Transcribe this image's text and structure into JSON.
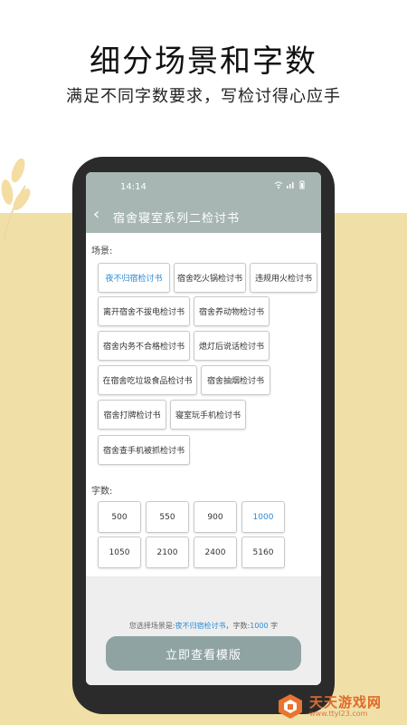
{
  "promo": {
    "headline": "细分场景和字数",
    "subline": "满足不同字数要求，写检讨得心应手"
  },
  "statusbar": {
    "time": "14:14",
    "icons": [
      "wifi-icon",
      "signal-icon",
      "battery-icon"
    ]
  },
  "titlebar": {
    "title": "宿舍寝室系列二检讨书"
  },
  "scenes": {
    "label": "场景:",
    "items": [
      {
        "label": "夜不归宿检讨书",
        "selected": true
      },
      {
        "label": "宿舍吃火锅检讨书",
        "selected": false
      },
      {
        "label": "违规用火检讨书",
        "selected": false
      },
      {
        "label": "离开宿舍不拔电检讨书",
        "selected": false
      },
      {
        "label": "宿舍养动物检讨书",
        "selected": false
      },
      {
        "label": "宿舍内务不合格检讨书",
        "selected": false
      },
      {
        "label": "熄灯后说话检讨书",
        "selected": false
      },
      {
        "label": "在宿舍吃垃圾食品检讨书",
        "selected": false
      },
      {
        "label": "宿舍抽烟检讨书",
        "selected": false
      },
      {
        "label": "宿舍打牌检讨书",
        "selected": false
      },
      {
        "label": "寝室玩手机检讨书",
        "selected": false
      },
      {
        "label": "宿舍查手机被抓检讨书",
        "selected": false
      }
    ]
  },
  "counts": {
    "label": "字数:",
    "items": [
      {
        "label": "500",
        "selected": false
      },
      {
        "label": "550",
        "selected": false
      },
      {
        "label": "900",
        "selected": false
      },
      {
        "label": "1000",
        "selected": true
      },
      {
        "label": "1050",
        "selected": false
      },
      {
        "label": "2100",
        "selected": false
      },
      {
        "label": "2400",
        "selected": false
      },
      {
        "label": "5160",
        "selected": false
      }
    ]
  },
  "summary": {
    "prefix": "您选择场景是:",
    "scene": "夜不归宿检讨书",
    "mid": "，字数:",
    "count": "1000",
    "suffix": " 字"
  },
  "cta": {
    "label": "立即查看模版"
  },
  "watermark": {
    "text": "天天游戏网",
    "url": "www.ttyl23.com"
  },
  "colors": {
    "accent": "#2a8bd6",
    "header": "#a7b6b3",
    "button": "#8fa3a3",
    "background": "#f0e0a8"
  }
}
